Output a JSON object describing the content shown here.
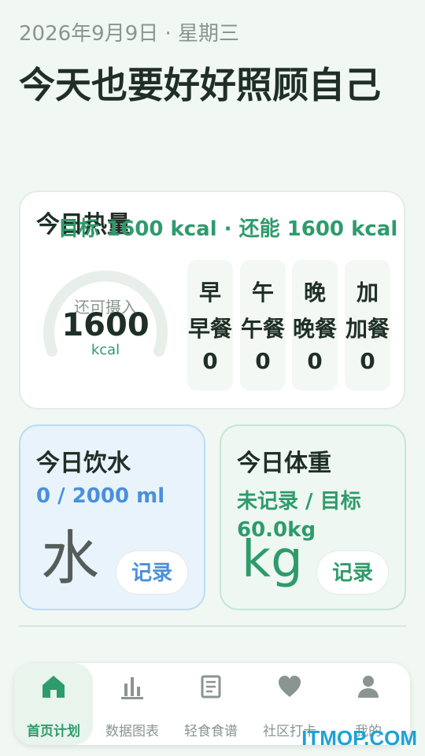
{
  "header": {
    "date": "2026年9月9日 · 星期三",
    "greeting": "今天也要好好照顾自己"
  },
  "calories": {
    "title": "今日热量",
    "subtitle": "目标 1600 kcal · 还能 1600 kcal",
    "gauge_label": "还可摄入",
    "gauge_value": "1600",
    "gauge_unit": "kcal",
    "gauge_progress": 0,
    "meals": [
      {
        "short": "早",
        "name": "早餐",
        "value": "0"
      },
      {
        "short": "午",
        "name": "午餐",
        "value": "0"
      },
      {
        "short": "晚",
        "name": "晚餐",
        "value": "0"
      },
      {
        "short": "加",
        "name": "加餐",
        "value": "0"
      }
    ]
  },
  "water": {
    "title": "今日饮水",
    "value": "0 / 2000 ml",
    "icon_text": "水",
    "record_label": "记录",
    "color": "#4a90d9"
  },
  "weight": {
    "title": "今日体重",
    "value": "未记录 / 目标 60.0kg",
    "icon_text": "kg",
    "record_label": "记录",
    "color": "#2e9b6b"
  },
  "tabs": [
    {
      "label": "首页计划",
      "icon": "home-icon",
      "active": true
    },
    {
      "label": "数据图表",
      "icon": "bar-chart-icon",
      "active": false
    },
    {
      "label": "轻食食谱",
      "icon": "book-icon",
      "active": false
    },
    {
      "label": "社区打卡",
      "icon": "heart-icon",
      "active": false
    },
    {
      "label": "我的",
      "icon": "user-icon",
      "active": false
    }
  ],
  "watermark": "ITMOP.COM",
  "colors": {
    "accent": "#2e9b6b",
    "background": "#f1f7f2",
    "water_accent": "#4a90d9"
  }
}
